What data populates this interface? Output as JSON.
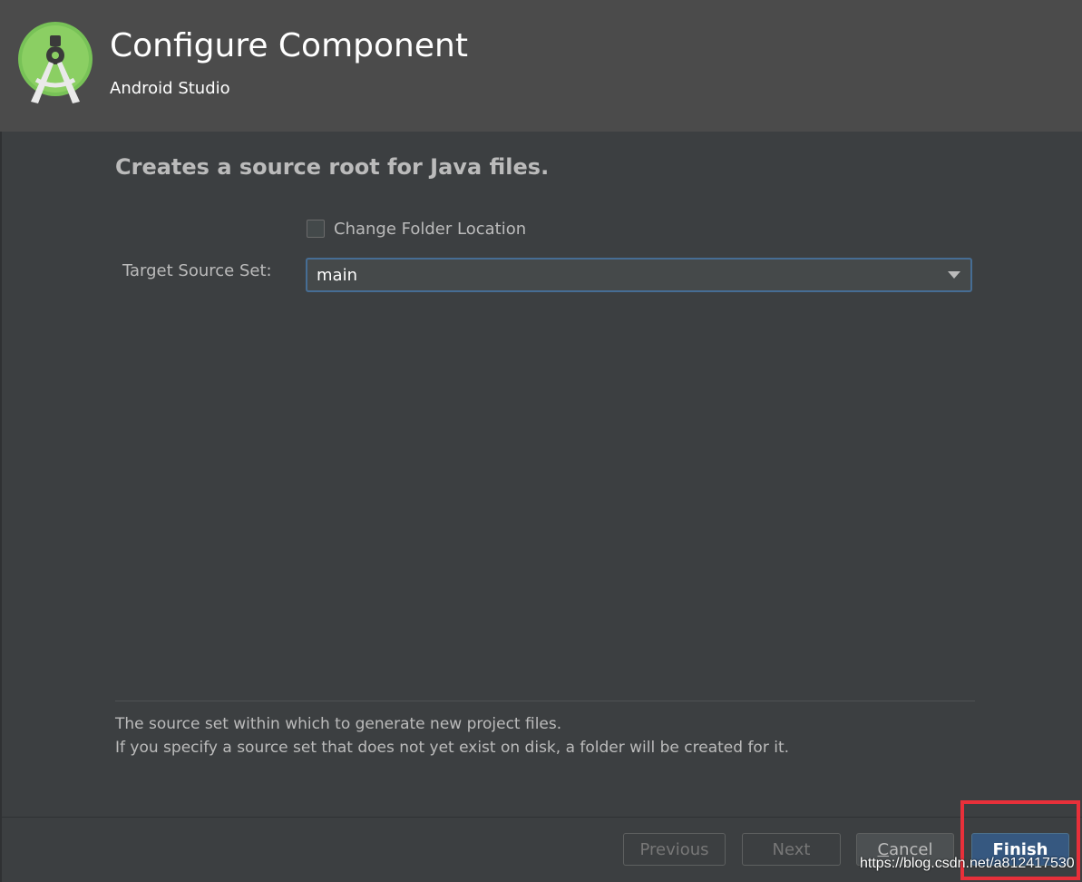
{
  "header": {
    "title": "Configure Component",
    "subtitle": "Android Studio",
    "logo_icon": "android-studio-icon"
  },
  "main": {
    "heading": "Creates a source root for Java files.",
    "checkbox": {
      "label": "Change Folder Location",
      "checked": false
    },
    "target_source_set": {
      "label": "Target Source Set:",
      "value": "main"
    },
    "help": {
      "line1": "The source set within which to generate new project files.",
      "line2": "If you specify a source set that does not yet exist on disk, a folder will be created for it."
    }
  },
  "footer": {
    "previous_label": "Previous",
    "next_label": "Next",
    "cancel_first": "C",
    "cancel_rest": "ancel",
    "finish_label": "Finish"
  },
  "watermark": "https://blog.csdn.net/a812417530",
  "colors": {
    "background": "#3c3f41",
    "header": "#4b4b4b",
    "accent": "#365880",
    "highlight": "#e8303a",
    "logo_green": "#78c257"
  }
}
